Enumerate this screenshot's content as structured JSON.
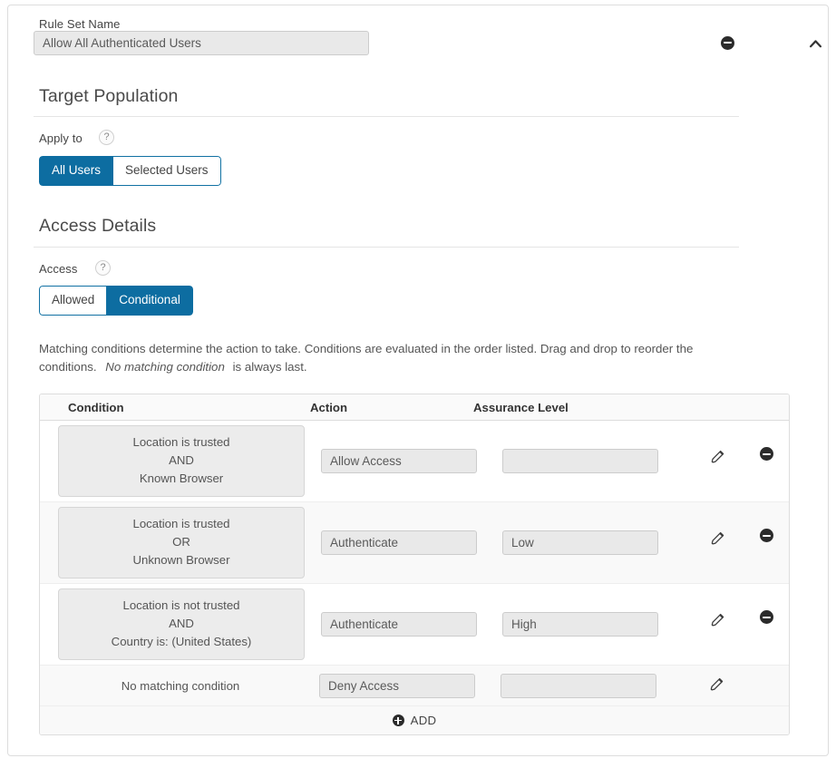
{
  "card": {
    "rule_set_name_label": "Rule Set Name",
    "rule_set_name_value": "Allow All Authenticated Users",
    "rule_set_name_placeholder": "Rule Set Name",
    "remove_icon": "minus-circle-icon",
    "collapse_icon": "chevron-up-icon"
  },
  "target_population": {
    "heading": "Target Population",
    "apply_to_label": "Apply to",
    "help_glyph": "?",
    "options": [
      {
        "label": "All Users",
        "active": true
      },
      {
        "label": "Selected Users",
        "active": false
      }
    ]
  },
  "access_details": {
    "heading": "Access Details",
    "access_label": "Access",
    "help_glyph": "?",
    "options": [
      {
        "label": "Allowed",
        "active": false
      },
      {
        "label": "Conditional",
        "active": true
      }
    ],
    "description_part1": "Matching conditions determine the action to take. Conditions are evaluated in the order listed. Drag and drop to reorder the conditions.",
    "description_emphasis": "No matching condition",
    "description_part2": "is always last."
  },
  "conditions_table": {
    "columns": [
      "Condition",
      "Action",
      "Assurance Level"
    ],
    "rows": [
      {
        "condition_lines": [
          "Location is trusted",
          "AND",
          "Known Browser"
        ],
        "action": "Allow Access",
        "assurance": "",
        "removable": true,
        "boxed": true
      },
      {
        "condition_lines": [
          "Location is trusted",
          "OR",
          "Unknown Browser"
        ],
        "action": "Authenticate",
        "assurance": "Low",
        "removable": true,
        "boxed": true
      },
      {
        "condition_lines": [
          "Location is not trusted",
          "AND",
          "Country is: (United States)"
        ],
        "action": "Authenticate",
        "assurance": "High",
        "removable": true,
        "boxed": true
      },
      {
        "condition_lines": [
          "No matching condition"
        ],
        "action": "Deny Access",
        "assurance": "",
        "removable": false,
        "boxed": false
      }
    ],
    "edit_icon": "pencil-icon",
    "remove_icon": "minus-circle-icon",
    "add_icon": "plus-circle-icon",
    "add_label": "ADD"
  },
  "colors": {
    "accent_blue": "#0d6da1",
    "accent_blue_border": "#1171a3",
    "field_bg": "#e9e9e9",
    "card_border": "#dddddd",
    "stripe_bg": "#f9f9f9",
    "text": "#555555"
  }
}
